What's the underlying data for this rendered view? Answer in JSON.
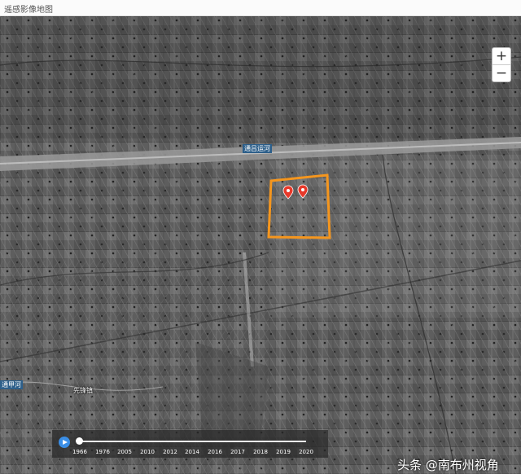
{
  "window": {
    "title": "遥感影像地图"
  },
  "zoom": {
    "in_label": "+",
    "out_label": "−"
  },
  "labels": {
    "canal": "通吕运河",
    "river": "通甲河",
    "town": "先锋镇"
  },
  "markers": [
    {
      "icon": "map-pin-icon",
      "color": "#e8392a"
    },
    {
      "icon": "map-pin-icon",
      "color": "#e8392a"
    }
  ],
  "highlight": {
    "color": "#f5961e"
  },
  "timeline": {
    "play_icon": "play-icon",
    "years": [
      "1966",
      "1976",
      "2005",
      "2010",
      "2012",
      "2014",
      "2016",
      "2017",
      "2018",
      "2019",
      "2020"
    ],
    "selected": "1966"
  },
  "watermark": "头条 @南布州视角"
}
